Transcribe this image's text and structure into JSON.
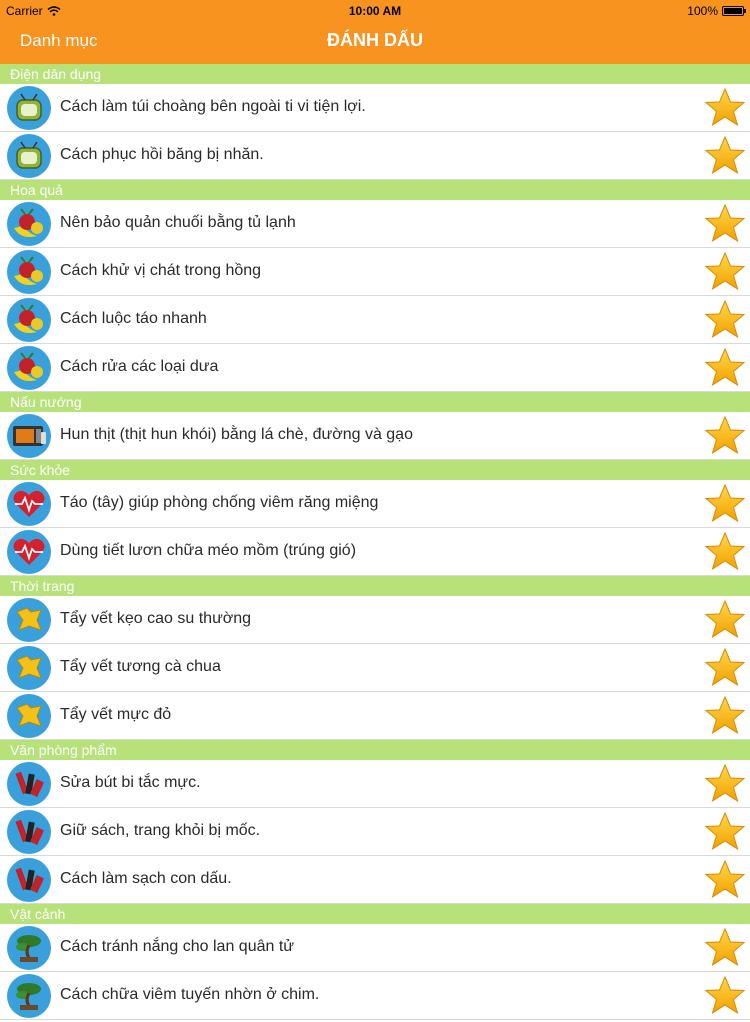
{
  "status_bar": {
    "carrier": "Carrier",
    "time": "10:00 AM",
    "battery": "100%"
  },
  "navbar": {
    "back_label": "Danh mục",
    "title": "ĐÁNH DẤU"
  },
  "colors": {
    "accent": "#f7931e",
    "section": "#b7e27a",
    "icon_bg": "#3aa0dc",
    "star": "#f7b500"
  },
  "sections": [
    {
      "title": "Điện dân dụng",
      "icon": "tv-icon",
      "items": [
        "Cách làm túi choàng bên ngoài ti vi tiện lợi.",
        "Cách phục hồi băng bị nhăn."
      ]
    },
    {
      "title": "Hoa quả",
      "icon": "fruit-icon",
      "items": [
        "Nên bảo quản chuối bằng tủ lạnh",
        "Cách khử vị chát trong hồng",
        "Cách luộc táo nhanh",
        "Cách rửa các loại dưa"
      ]
    },
    {
      "title": "Nấu nướng",
      "icon": "oven-icon",
      "items": [
        "Hun thịt (thịt hun khói) bằng lá chè, đường và gạo"
      ]
    },
    {
      "title": "Sức khỏe",
      "icon": "heart-icon",
      "items": [
        "Táo (tây) giúp phòng chống viêm răng miệng",
        "Dùng tiết lươn chữa méo mồm (trúng gió)"
      ]
    },
    {
      "title": "Thời trang",
      "icon": "clothes-icon",
      "items": [
        "Tẩy vết kẹo cao su thường",
        "Tẩy vết tương cà chua",
        "Tẩy vết mực đỏ"
      ]
    },
    {
      "title": "Văn phòng phẩm",
      "icon": "pens-icon",
      "items": [
        "Sửa bút bi tắc mực.",
        "Giữ sách, trang khỏi bị mốc.",
        "Cách làm sạch con dấu."
      ]
    },
    {
      "title": "Vật cảnh",
      "icon": "bonsai-icon",
      "items": [
        "Cách tránh nắng cho lan quân tử",
        "Cách chữa viêm tuyến nhờn ở chim."
      ]
    }
  ]
}
